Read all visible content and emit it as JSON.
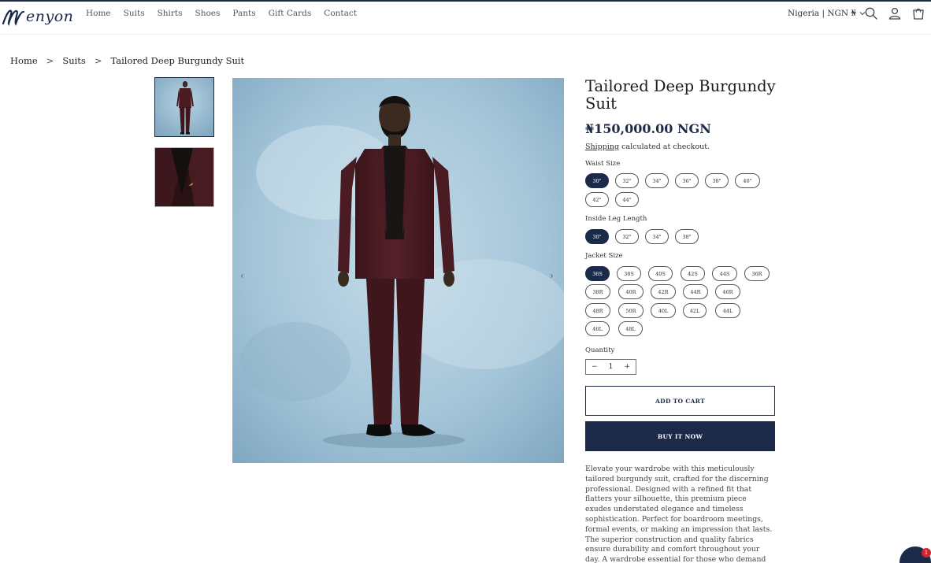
{
  "brand": {
    "logo_text": "enyon",
    "accent": "#1b2a49"
  },
  "nav": {
    "items": [
      "Home",
      "Suits",
      "Shirts",
      "Shoes",
      "Pants",
      "Gift Cards",
      "Contact"
    ]
  },
  "header": {
    "region": "Nigeria | NGN ₦",
    "icons": [
      "search-icon",
      "account-icon",
      "cart-icon"
    ]
  },
  "breadcrumb": {
    "items": [
      "Home",
      "Suits",
      "Tailored Deep Burgundy Suit"
    ],
    "separator": ">"
  },
  "gallery": {
    "prev": "‹",
    "next": "›"
  },
  "product": {
    "title": "Tailored Deep Burgundy Suit",
    "price": "₦150,000.00 NGN",
    "shipping_link": "Shipping",
    "shipping_text": " calculated at checkout.",
    "waist": {
      "label": "Waist Size",
      "options": [
        "30\"",
        "32\"",
        "34\"",
        "36\"",
        "38\"",
        "40\"",
        "42\"",
        "44\""
      ],
      "selected": "30\""
    },
    "leg": {
      "label": "Inside Leg Length",
      "options": [
        "30\"",
        "32\"",
        "34\"",
        "38\""
      ],
      "selected": "30\""
    },
    "jacket": {
      "label": "Jacket Size",
      "options": [
        "36S",
        "38S",
        "40S",
        "42S",
        "44S",
        "36R",
        "38R",
        "40R",
        "42R",
        "44R",
        "46R",
        "48R",
        "50R",
        "40L",
        "42L",
        "44L",
        "46L",
        "48L"
      ],
      "selected": "36S"
    },
    "quantity": {
      "label": "Quantity",
      "value": "1",
      "minus": "−",
      "plus": "+"
    },
    "add_to_cart": "ADD TO CART",
    "buy_now": "BUY IT NOW",
    "description": "Elevate your wardrobe with this meticulously tailored burgundy suit, crafted for the discerning professional. Designed with a refined fit that flatters your silhouette, this premium piece exudes understated elegance and timeless sophistication. Perfect for boardroom meetings, formal events, or making an impression that lasts. The superior construction and quality fabrics ensure durability and comfort throughout your day. A wardrobe essential for those who demand excellence in every"
  },
  "chat": {
    "badge": "1"
  }
}
